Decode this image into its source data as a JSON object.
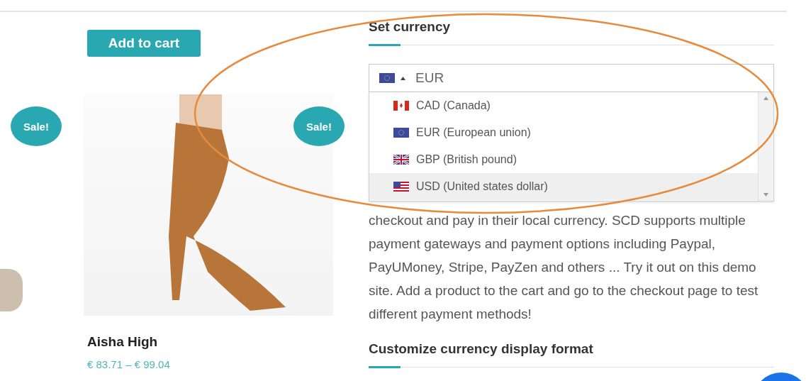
{
  "products": [
    {
      "button": "Add to cart",
      "name": "Aisha High",
      "price": "€ 83.71 – € 99.04"
    }
  ],
  "side_badges": [
    "Sale!",
    "Sale!"
  ],
  "currency": {
    "heading": "Set currency",
    "current": {
      "code": "EUR",
      "kind": "eu"
    },
    "open": true,
    "options": [
      {
        "label": "CAD (Canada)",
        "kind": "ca",
        "selected": false
      },
      {
        "label": "EUR (European union)",
        "kind": "eu",
        "selected": false
      },
      {
        "label": "GBP (British pound)",
        "kind": "gb",
        "selected": false
      },
      {
        "label": "USD (United states dollar)",
        "kind": "us",
        "selected": true
      }
    ]
  },
  "description": "checkout and pay in their local currency. SCD supports multiple payment gateways and payment options including Paypal, PayUMoney, Stripe, PayZen and others ... Try it out on this demo site. Add a product to the cart and go to the checkout page to test different payment methods!",
  "format_heading": "Customize currency display format"
}
